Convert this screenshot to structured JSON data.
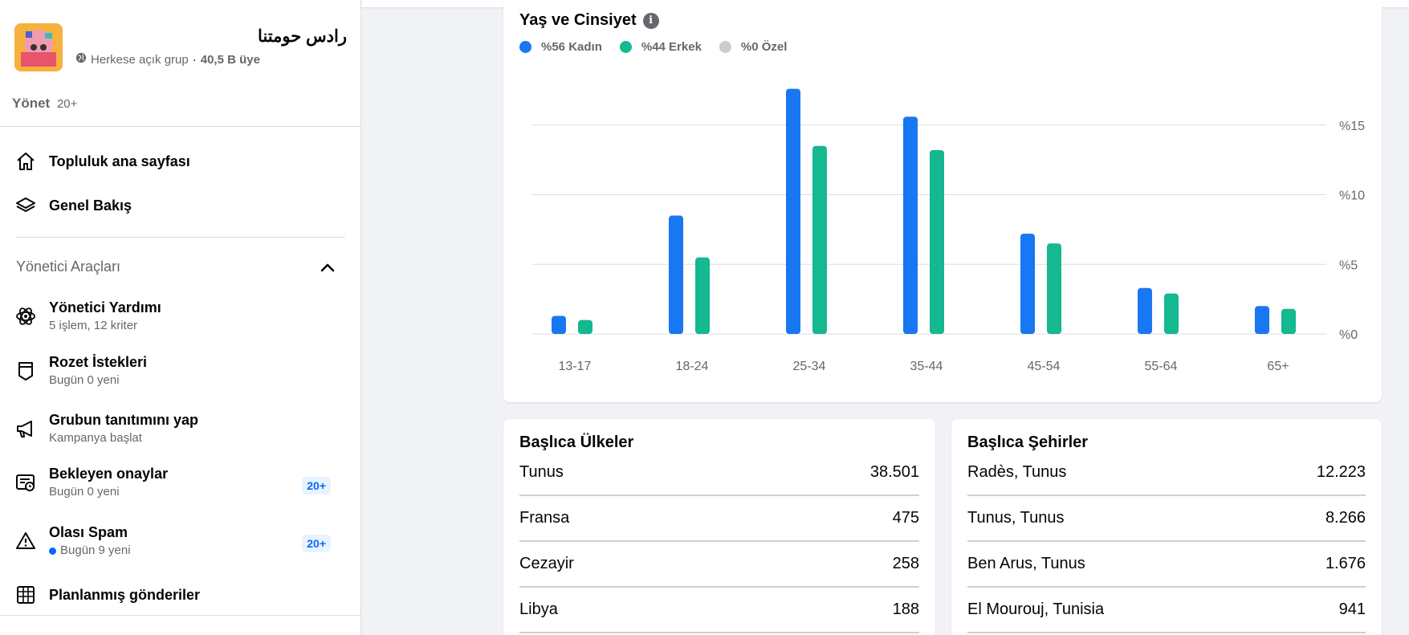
{
  "group": {
    "name": "رادس حومتنا",
    "privacy": "Herkese açık grup",
    "separator": "·",
    "members": "40,5 B üye",
    "manage_label": "Yönet",
    "manage_count": "20+"
  },
  "nav": {
    "community_home": "Topluluk ana sayfası",
    "overview": "Genel Bakış",
    "admin_tools_title": "Yönetici Araçları",
    "admin_assist": {
      "title": "Yönetici Yardımı",
      "sub": "5 işlem, 12 kriter"
    },
    "badge_requests": {
      "title": "Rozet İstekleri",
      "sub": "Bugün 0 yeni"
    },
    "promote": {
      "title": "Grubun tanıtımını yap",
      "sub": "Kampanya başlat"
    },
    "pending": {
      "title": "Bekleyen onaylar",
      "sub": "Bugün 0 yeni",
      "badge": "20+"
    },
    "spam": {
      "title": "Olası Spam",
      "sub": "Bugün 9 yeni",
      "badge": "20+"
    },
    "scheduled": {
      "title": "Planlanmış gönderiler"
    }
  },
  "colors": {
    "women": "#1877f2",
    "men": "#14b891",
    "other": "#c9ccd1"
  },
  "chart_data": {
    "type": "bar",
    "title": "Yaş ve Cinsiyet",
    "categories": [
      "13-17",
      "18-24",
      "25-34",
      "35-44",
      "45-54",
      "55-64",
      "65+"
    ],
    "series": [
      {
        "name": "%56 Kadın",
        "values": [
          1.3,
          8.5,
          17.6,
          15.6,
          7.2,
          3.3,
          2.0
        ]
      },
      {
        "name": "%44 Erkek",
        "values": [
          1.0,
          5.5,
          13.5,
          13.2,
          6.5,
          2.9,
          1.8
        ]
      },
      {
        "name": "%0 Özel",
        "values": [
          0,
          0,
          0,
          0,
          0,
          0,
          0
        ]
      }
    ],
    "yticks": [
      "%0",
      "%5",
      "%10",
      "%15"
    ],
    "ylim": [
      0,
      18
    ],
    "grid": true,
    "legend_position": "top-left"
  },
  "countries": {
    "title": "Başlıca Ülkeler",
    "rows": [
      {
        "name": "Tunus",
        "value": "38.501"
      },
      {
        "name": "Fransa",
        "value": "475"
      },
      {
        "name": "Cezayir",
        "value": "258"
      },
      {
        "name": "Libya",
        "value": "188"
      }
    ]
  },
  "cities": {
    "title": "Başlıca Şehirler",
    "rows": [
      {
        "name": "Radès, Tunus",
        "value": "12.223"
      },
      {
        "name": "Tunus, Tunus",
        "value": "8.266"
      },
      {
        "name": "Ben Arus, Tunus",
        "value": "1.676"
      },
      {
        "name": "El Mourouj, Tunisia",
        "value": "941"
      }
    ]
  }
}
